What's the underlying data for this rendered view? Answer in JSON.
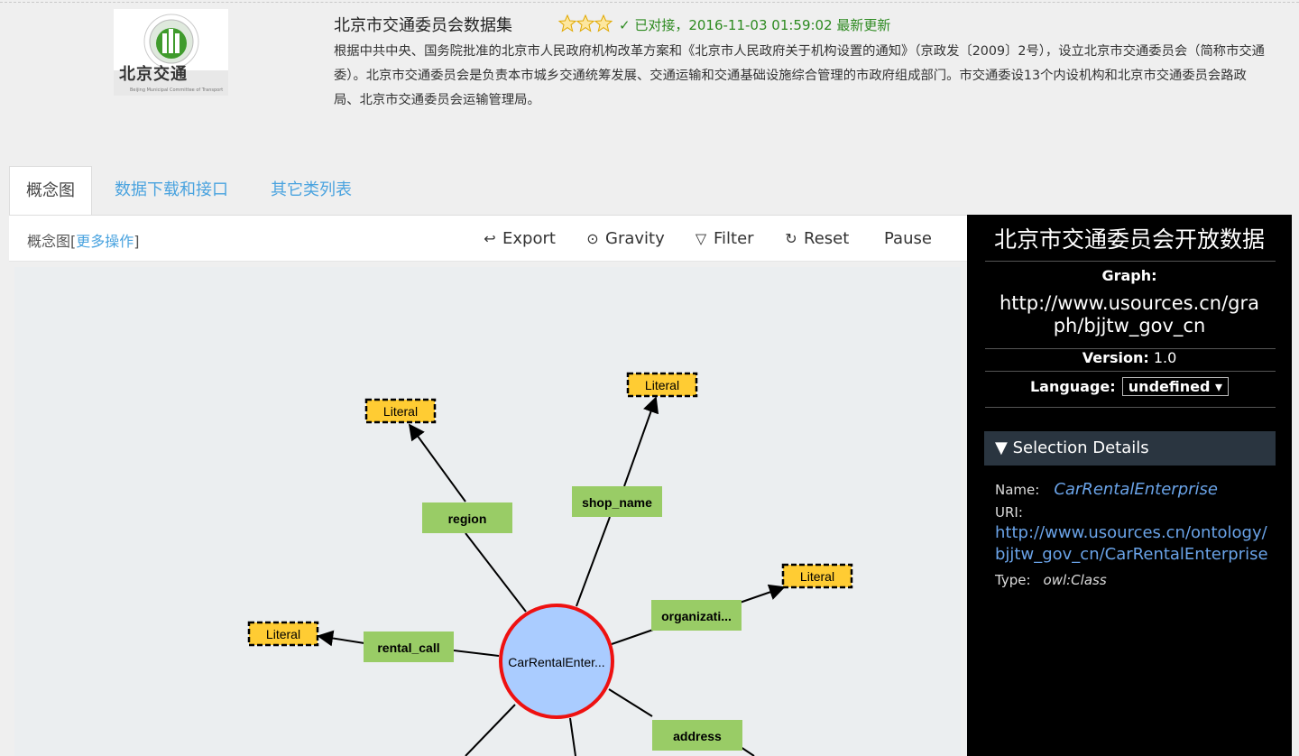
{
  "header": {
    "title": "北京市交通委员会数据集",
    "status": "✓ 已对接，2016-11-03 01:59:02 最新更新",
    "description": "根据中共中央、国务院批准的北京市人民政府机构改革方案和《北京市人民政府关于机构设置的通知》（京政发〔2009〕2号），设立北京市交通委员会（简称市交通委）。北京市交通委员会是负责本市城乡交通统筹发展、交通运输和交通基础设施综合管理的市政府组成部门。市交通委设13个内设机构和北京市交通委员会路政局、北京市交通委员会运输管理局。",
    "logo_text": "北京交通",
    "logo_subtext": "Beijing Municipal Committee of Transport",
    "rating_stars": 3
  },
  "tabs": [
    {
      "label": "概念图",
      "active": true
    },
    {
      "label": "数据下载和接口",
      "active": false
    },
    {
      "label": "其它类列表",
      "active": false
    }
  ],
  "toolbar": {
    "left_label": "概念图",
    "more_label": "更多操作",
    "export": "Export",
    "gravity": "Gravity",
    "filter": "Filter",
    "reset": "Reset",
    "pause": "Pause"
  },
  "graph": {
    "center": "CarRentalEnter...",
    "properties": [
      "region",
      "shop_name",
      "organizati...",
      "rental_call",
      "address"
    ],
    "literal": "Literal"
  },
  "panel": {
    "title": "北京市交通委员会开放数据",
    "graph_label": "Graph:",
    "graph_uri": "http://www.usources.cn/graph/bjjtw_gov_cn",
    "version_label": "Version:",
    "version": "1.0",
    "language_label": "Language:",
    "language": "undefined",
    "selection_header": "▼ Selection Details",
    "name_label": "Name:",
    "name": "CarRentalEnterprise",
    "uri_label": "URI:",
    "uri": "http://www.usources.cn/ontology/bjjtw_gov_cn/CarRentalEnterprise",
    "type_label": "Type:",
    "type": "owl:Class"
  },
  "colors": {
    "link": "#4aa3df",
    "status_green": "#2d8a20",
    "property_node": "#99cc66",
    "literal_node": "#ffcc33",
    "class_node": "#aaccff",
    "class_border": "#ee1111",
    "panel_bg": "#000000"
  }
}
